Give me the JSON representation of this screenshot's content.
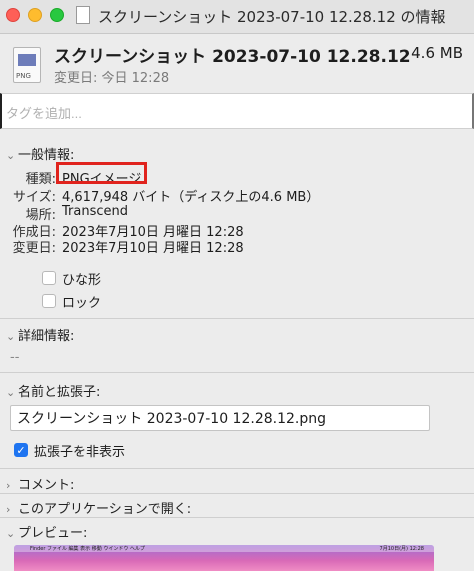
{
  "window": {
    "title": "スクリーンショット 2023-07-10 12.28.12 の情報",
    "icon": "png-file-icon"
  },
  "file": {
    "name": "スクリーンショット 2023-07-10 12.28.12",
    "size": "4.6 MB",
    "modified": "変更日: 今日 12:28",
    "icon_badge": "PNG"
  },
  "tags": {
    "placeholder": "タグを追加..."
  },
  "general": {
    "header": "一般情報:",
    "rows": [
      {
        "label": "種類:",
        "value": "PNGイメージ"
      },
      {
        "label": "サイズ:",
        "value": "4,617,948 バイト（ディスク上の4.6 MB）"
      },
      {
        "label": "場所:",
        "value": "Transcend"
      },
      {
        "label": "作成日:",
        "value": "2023年7月10日 月曜日 12:28"
      },
      {
        "label": "変更日:",
        "value": "2023年7月10日 月曜日 12:28"
      }
    ],
    "checkboxes": [
      {
        "label": "ひな形",
        "checked": false
      },
      {
        "label": "ロック",
        "checked": false
      }
    ],
    "highlight_color": "#e0231d"
  },
  "details": {
    "header": "詳細情報:",
    "value": "--"
  },
  "name_ext": {
    "header": "名前と拡張子:",
    "value": "スクリーンショット 2023-07-10 12.28.12.png",
    "hide_ext_label": "拡張子を非表示",
    "hide_ext_checked": true
  },
  "comments": {
    "header": "コメント:"
  },
  "open_with": {
    "header": "このアプリケーションで開く:"
  },
  "preview": {
    "header": "プレビュー:",
    "menu_text": "Finder  ファイル  編集  表示  移動  ウインドウ  ヘルプ",
    "status_text": "7月10日(月) 12:28"
  },
  "colors": {
    "accent": "#1e74f0",
    "background": "#ececec"
  }
}
